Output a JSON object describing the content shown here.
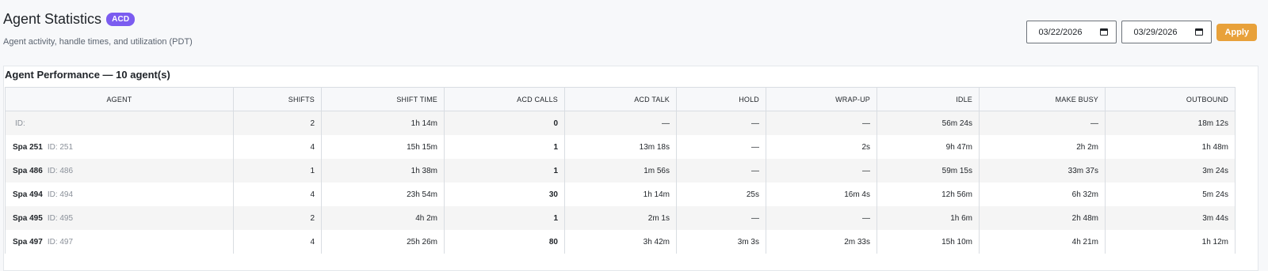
{
  "header": {
    "title": "Agent Statistics",
    "badge": "ACD",
    "subtitle": "Agent activity, handle times, and utilization (PDT)"
  },
  "controls": {
    "start_date": "03/22/2026",
    "end_date": "03/29/2026",
    "apply_label": "Apply"
  },
  "table": {
    "title": "Agent Performance — 10 agent(s)",
    "columns": [
      "AGENT",
      "SHIFTS",
      "SHIFT TIME",
      "ACD CALLS",
      "ACD TALK",
      "HOLD",
      "WRAP-UP",
      "IDLE",
      "MAKE BUSY",
      "OUTBOUND"
    ],
    "rows": [
      {
        "name": "",
        "id": "ID:",
        "shifts": "2",
        "shift_time": "1h 14m",
        "acd_calls": "0",
        "acd_talk": "—",
        "hold": "—",
        "wrapup": "—",
        "idle": "56m 24s",
        "make_busy": "—",
        "outbound": "18m 12s"
      },
      {
        "name": "Spa 251",
        "id": "ID: 251",
        "shifts": "4",
        "shift_time": "15h 15m",
        "acd_calls": "1",
        "acd_talk": "13m 18s",
        "hold": "—",
        "wrapup": "2s",
        "idle": "9h 47m",
        "make_busy": "2h 2m",
        "outbound": "1h 48m"
      },
      {
        "name": "Spa 486",
        "id": "ID: 486",
        "shifts": "1",
        "shift_time": "1h 38m",
        "acd_calls": "1",
        "acd_talk": "1m 56s",
        "hold": "—",
        "wrapup": "—",
        "idle": "59m 15s",
        "make_busy": "33m 37s",
        "outbound": "3m 24s"
      },
      {
        "name": "Spa 494",
        "id": "ID: 494",
        "shifts": "4",
        "shift_time": "23h 54m",
        "acd_calls": "30",
        "acd_talk": "1h 14m",
        "hold": "25s",
        "wrapup": "16m 4s",
        "idle": "12h 56m",
        "make_busy": "6h 32m",
        "outbound": "5m 24s"
      },
      {
        "name": "Spa 495",
        "id": "ID: 495",
        "shifts": "2",
        "shift_time": "4h 2m",
        "acd_calls": "1",
        "acd_talk": "2m 1s",
        "hold": "—",
        "wrapup": "—",
        "idle": "1h 6m",
        "make_busy": "2h 48m",
        "outbound": "3m 44s"
      },
      {
        "name": "Spa 497",
        "id": "ID: 497",
        "shifts": "4",
        "shift_time": "25h 26m",
        "acd_calls": "80",
        "acd_talk": "3h 42m",
        "hold": "3m 3s",
        "wrapup": "2m 33s",
        "idle": "15h 10m",
        "make_busy": "4h 21m",
        "outbound": "1h 12m"
      }
    ]
  }
}
